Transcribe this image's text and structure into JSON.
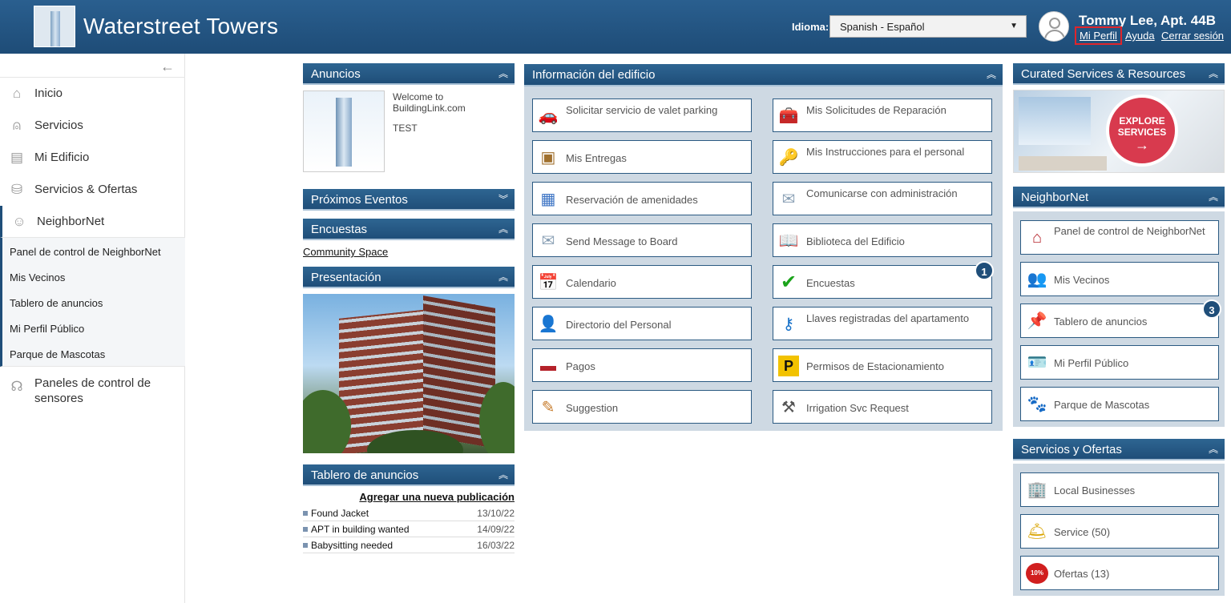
{
  "header": {
    "app_title": "Waterstreet Towers",
    "language_label": "Idioma:",
    "language_value": "Spanish - Español",
    "user_name": "Tommy Lee, Apt. 44B",
    "links": {
      "profile": "Mi Perfil",
      "help": "Ayuda",
      "logout": "Cerrar sesión"
    }
  },
  "sidebar": {
    "collapse_icon": "arrow-left-icon",
    "items": [
      {
        "label": "Inicio",
        "icon": "home-icon"
      },
      {
        "label": "Servicios",
        "icon": "service-bell-icon"
      },
      {
        "label": "Mi Edificio",
        "icon": "building-icon"
      },
      {
        "label": "Servicios & Ofertas",
        "icon": "basket-icon"
      },
      {
        "label": "NeighborNet",
        "icon": "people-icon"
      },
      {
        "label": "Paneles de control de sensores",
        "icon": "antenna-icon"
      }
    ],
    "neighbornet_sub": [
      "Panel de control de NeighborNet",
      "Mis Vecinos",
      "Tablero de anuncios",
      "Mi Perfil Público",
      "Parque de Mascotas"
    ]
  },
  "announcements": {
    "title": "Anuncios",
    "welcome": "Welcome to BuildingLink.com",
    "test": "TEST"
  },
  "events": {
    "title": "Próximos Eventos"
  },
  "surveys": {
    "title": "Encuestas",
    "link": "Community Space"
  },
  "presentation": {
    "title": "Presentación"
  },
  "board": {
    "title": "Tablero de anuncios",
    "add_label": "Agregar una nueva publicación",
    "posts": [
      {
        "title": "Found Jacket",
        "date": "13/10/22"
      },
      {
        "title": "APT in building wanted",
        "date": "14/09/22"
      },
      {
        "title": "Babysitting needed",
        "date": "16/03/22"
      }
    ]
  },
  "building_info": {
    "title": "Información del edificio",
    "left": [
      {
        "label": "Solicitar servicio de valet parking",
        "icon": "car-icon"
      },
      {
        "label": "Mis Entregas",
        "icon": "package-icon"
      },
      {
        "label": "Reservación de amenidades",
        "icon": "calendar-grid-icon"
      },
      {
        "label": "Send Message to Board",
        "icon": "envelope-icon"
      },
      {
        "label": "Calendario",
        "icon": "calendar-icon"
      },
      {
        "label": "Directorio del Personal",
        "icon": "staff-icon"
      },
      {
        "label": "Pagos",
        "icon": "credit-card-icon"
      },
      {
        "label": "Suggestion",
        "icon": "suggestion-box-icon"
      }
    ],
    "right": [
      {
        "label": "Mis Solicitudes de Reparación",
        "icon": "toolbox-icon"
      },
      {
        "label": "Mis Instrucciones para el personal",
        "icon": "key-icon"
      },
      {
        "label": "Comunicarse con administración",
        "icon": "envelope-icon"
      },
      {
        "label": "Biblioteca del Edificio",
        "icon": "book-icon"
      },
      {
        "label": "Encuestas",
        "icon": "checkmark-icon",
        "badge": "1"
      },
      {
        "label": "Llaves registradas del apartamento",
        "icon": "keys-icon"
      },
      {
        "label": "Permisos de Estacionamiento",
        "icon": "parking-icon"
      },
      {
        "label": "Irrigation Svc Request",
        "icon": "tools-icon"
      }
    ]
  },
  "curated": {
    "title": "Curated Services & Resources",
    "explore_label": "EXPLORE SERVICES"
  },
  "neighbornet": {
    "title": "NeighborNet",
    "items": [
      {
        "label": "Panel de control de NeighborNet",
        "icon": "house-icon"
      },
      {
        "label": "Mis Vecinos",
        "icon": "people-icon"
      },
      {
        "label": "Tablero de anuncios",
        "icon": "pushpin-icon",
        "badge": "3"
      },
      {
        "label": "Mi Perfil Público",
        "icon": "profile-card-icon"
      },
      {
        "label": "Parque de Mascotas",
        "icon": "paw-icon"
      }
    ]
  },
  "offers": {
    "title": "Servicios y Ofertas",
    "items": [
      {
        "label": "Local Businesses",
        "icon": "city-icon"
      },
      {
        "label": "Service (50)",
        "icon": "service-bell-icon"
      },
      {
        "label": "Ofertas (13)",
        "icon": "discount-badge-icon",
        "badge_text": "10%"
      }
    ]
  }
}
